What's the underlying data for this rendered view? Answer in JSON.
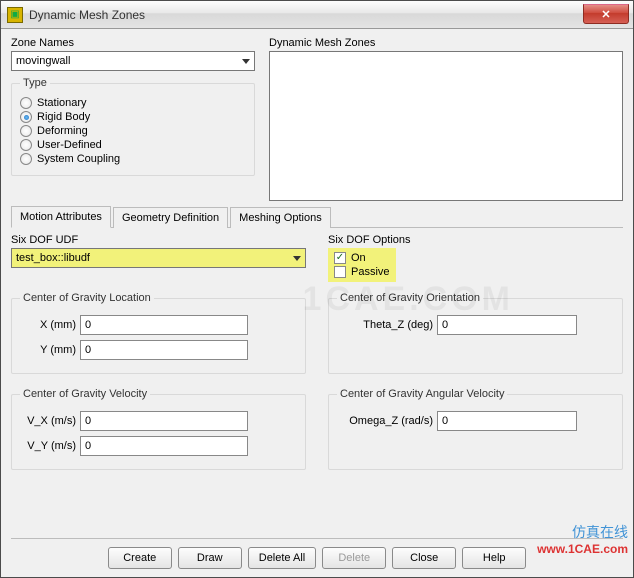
{
  "window": {
    "title": "Dynamic Mesh Zones"
  },
  "zoneNames": {
    "label": "Zone Names",
    "selected": "movingwall"
  },
  "type": {
    "legend": "Type",
    "options": [
      {
        "label": "Stationary",
        "selected": false
      },
      {
        "label": "Rigid Body",
        "selected": true
      },
      {
        "label": "Deforming",
        "selected": false
      },
      {
        "label": "User-Defined",
        "selected": false
      },
      {
        "label": "System Coupling",
        "selected": false
      }
    ]
  },
  "dmzList": {
    "label": "Dynamic Mesh Zones"
  },
  "tabs": [
    {
      "label": "Motion Attributes",
      "active": true
    },
    {
      "label": "Geometry Definition",
      "active": false
    },
    {
      "label": "Meshing Options",
      "active": false
    }
  ],
  "sixdof": {
    "udf_label": "Six DOF UDF",
    "udf_selected": "test_box::libudf",
    "options_label": "Six DOF Options",
    "on_label": "On",
    "on_checked": true,
    "passive_label": "Passive",
    "passive_checked": false
  },
  "cog_loc": {
    "legend": "Center of Gravity Location",
    "x_label": "X (mm)",
    "x_value": "0",
    "y_label": "Y (mm)",
    "y_value": "0"
  },
  "cog_orient": {
    "legend": "Center of Gravity Orientation",
    "tz_label": "Theta_Z (deg)",
    "tz_value": "0"
  },
  "cog_vel": {
    "legend": "Center of Gravity Velocity",
    "vx_label": "V_X (m/s)",
    "vx_value": "0",
    "vy_label": "V_Y (m/s)",
    "vy_value": "0"
  },
  "cog_angvel": {
    "legend": "Center of Gravity Angular Velocity",
    "wz_label": "Omega_Z (rad/s)",
    "wz_value": "0"
  },
  "buttons": {
    "create": "Create",
    "draw": "Draw",
    "delete_all": "Delete All",
    "delete": "Delete",
    "close": "Close",
    "help": "Help"
  },
  "branding": {
    "watermark": "1CAE.COM",
    "line1": "仿真在线",
    "line2": "www.1CAE.com"
  }
}
